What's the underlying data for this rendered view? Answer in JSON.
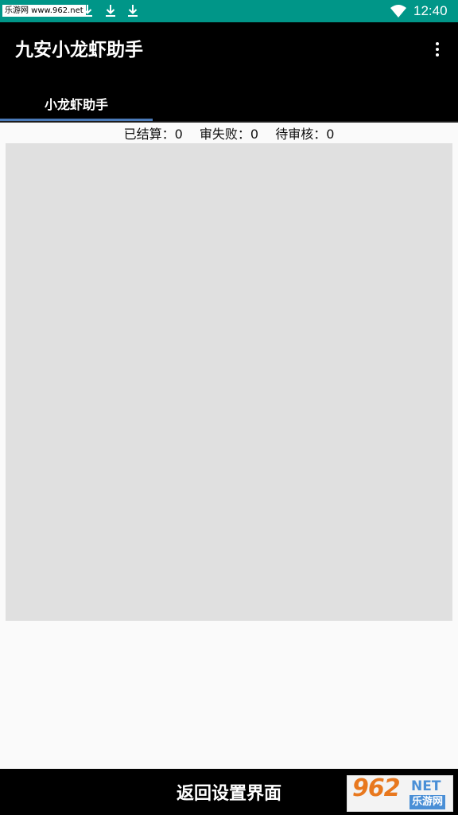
{
  "status_bar": {
    "watermark": "乐游网 www.962.net",
    "time": "12:40",
    "background": "#009688"
  },
  "app_bar": {
    "title": "九安小龙虾助手",
    "background": "#000000",
    "overflow_icon": "more-vert-icon"
  },
  "tabs": [
    {
      "label": "小龙虾助手",
      "selected": true
    }
  ],
  "stats": {
    "settled_label": "已结算：",
    "settled_value": "0",
    "failed_label": "审失败：",
    "failed_value": "0",
    "pending_label": "待审核：",
    "pending_value": "0"
  },
  "bottom_bar": {
    "back_label": "返回设置界面"
  },
  "watermark_logo": {
    "number": "962",
    "net": "NET",
    "name": "乐游网"
  }
}
